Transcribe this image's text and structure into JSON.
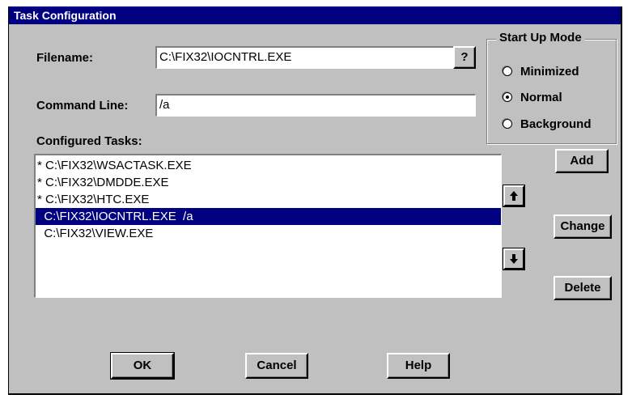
{
  "window": {
    "title": "Task Configuration"
  },
  "filename": {
    "label": "Filename:",
    "value": "C:\\FIX32\\IOCNTRL.EXE",
    "browse_label": "?"
  },
  "command_line": {
    "label": "Command Line:",
    "value": "/a"
  },
  "configured_tasks": {
    "label": "Configured Tasks:",
    "items": [
      {
        "text": "* C:\\FIX32\\WSACTASK.EXE",
        "selected": false
      },
      {
        "text": "* C:\\FIX32\\DMDDE.EXE",
        "selected": false
      },
      {
        "text": "* C:\\FIX32\\HTC.EXE",
        "selected": false
      },
      {
        "text": "  C:\\FIX32\\IOCNTRL.EXE  /a",
        "selected": true
      },
      {
        "text": "  C:\\FIX32\\VIEW.EXE",
        "selected": false
      }
    ]
  },
  "startup_mode": {
    "title": "Start Up Mode",
    "options": [
      "Minimized",
      "Normal",
      "Background"
    ],
    "selected": "Normal"
  },
  "buttons": {
    "add": "Add",
    "change": "Change",
    "delete": "Delete",
    "ok": "OK",
    "cancel": "Cancel",
    "help": "Help"
  },
  "icons": {
    "move_up": "arrow-up-icon",
    "move_down": "arrow-down-icon"
  },
  "colors": {
    "titlebar": "#000080",
    "selection": "#000080",
    "face": "#c0c0c0"
  }
}
